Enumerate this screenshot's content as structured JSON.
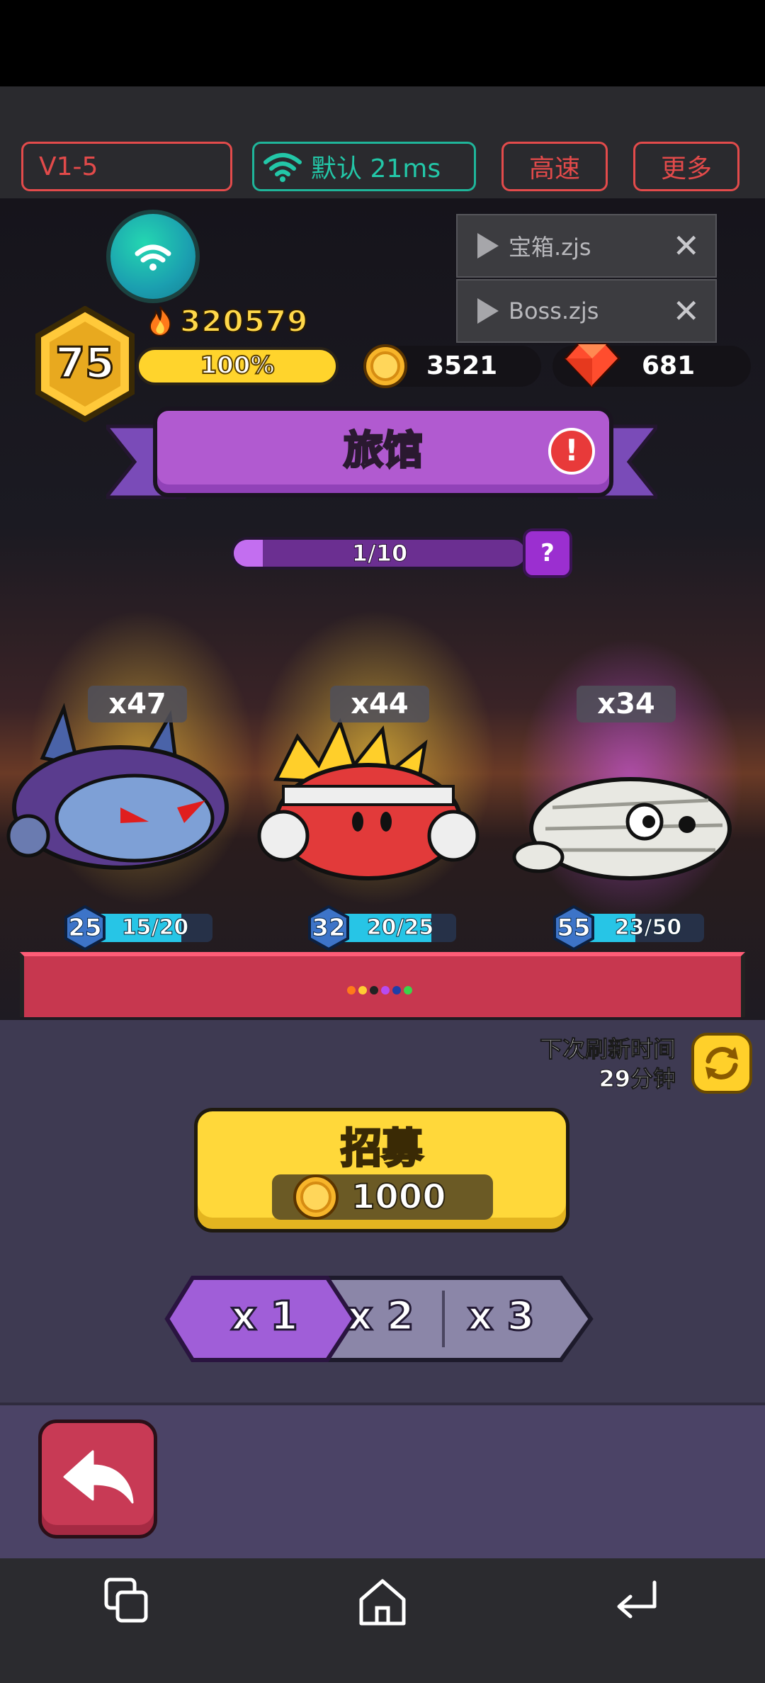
{
  "topbar": {
    "version": "V1-5",
    "network": "默认 21ms",
    "speed": "高速",
    "more": "更多"
  },
  "scripts": [
    {
      "name": "宝箱.zjs"
    },
    {
      "name": "Boss.zjs"
    }
  ],
  "player": {
    "level": "75",
    "power": "320579",
    "xp_percent": "100%",
    "xp_fraction": 1.0,
    "coins": "3521",
    "gems": "681"
  },
  "banner": {
    "title": "旅馆",
    "alert": "!"
  },
  "progress": {
    "label": "1/10",
    "fraction": 0.1,
    "help": "?"
  },
  "heroes": [
    {
      "count": "x47",
      "level": "25",
      "shards": "15/20",
      "fraction": 0.75,
      "glow": "#ffcc33"
    },
    {
      "count": "x44",
      "level": "32",
      "shards": "20/25",
      "fraction": 0.8,
      "glow": "#ffcc33"
    },
    {
      "count": "x34",
      "level": "55",
      "shards": "23/50",
      "fraction": 0.46,
      "glow": "#d75cff"
    }
  ],
  "refresh": {
    "line1": "下次刷新时间",
    "line2": "29分钟"
  },
  "recruit": {
    "title": "招募",
    "cost": "1000"
  },
  "multiplier": {
    "options": [
      "x 1",
      "x 2",
      "x 3"
    ],
    "selected": 0
  },
  "colors": {
    "accent_red": "#e34b4b",
    "accent_teal": "#23c7a8",
    "gold": "#ffd83a",
    "purple": "#b15ad0"
  },
  "icons": {
    "wifi": "wifi-icon",
    "fire": "fire-icon",
    "coin": "coin-icon",
    "gem": "gem-icon",
    "refresh": "refresh-icon",
    "back": "back-arrow-icon",
    "recent_apps": "recent-apps-icon",
    "home": "home-icon",
    "nav_back": "nav-back-icon"
  }
}
